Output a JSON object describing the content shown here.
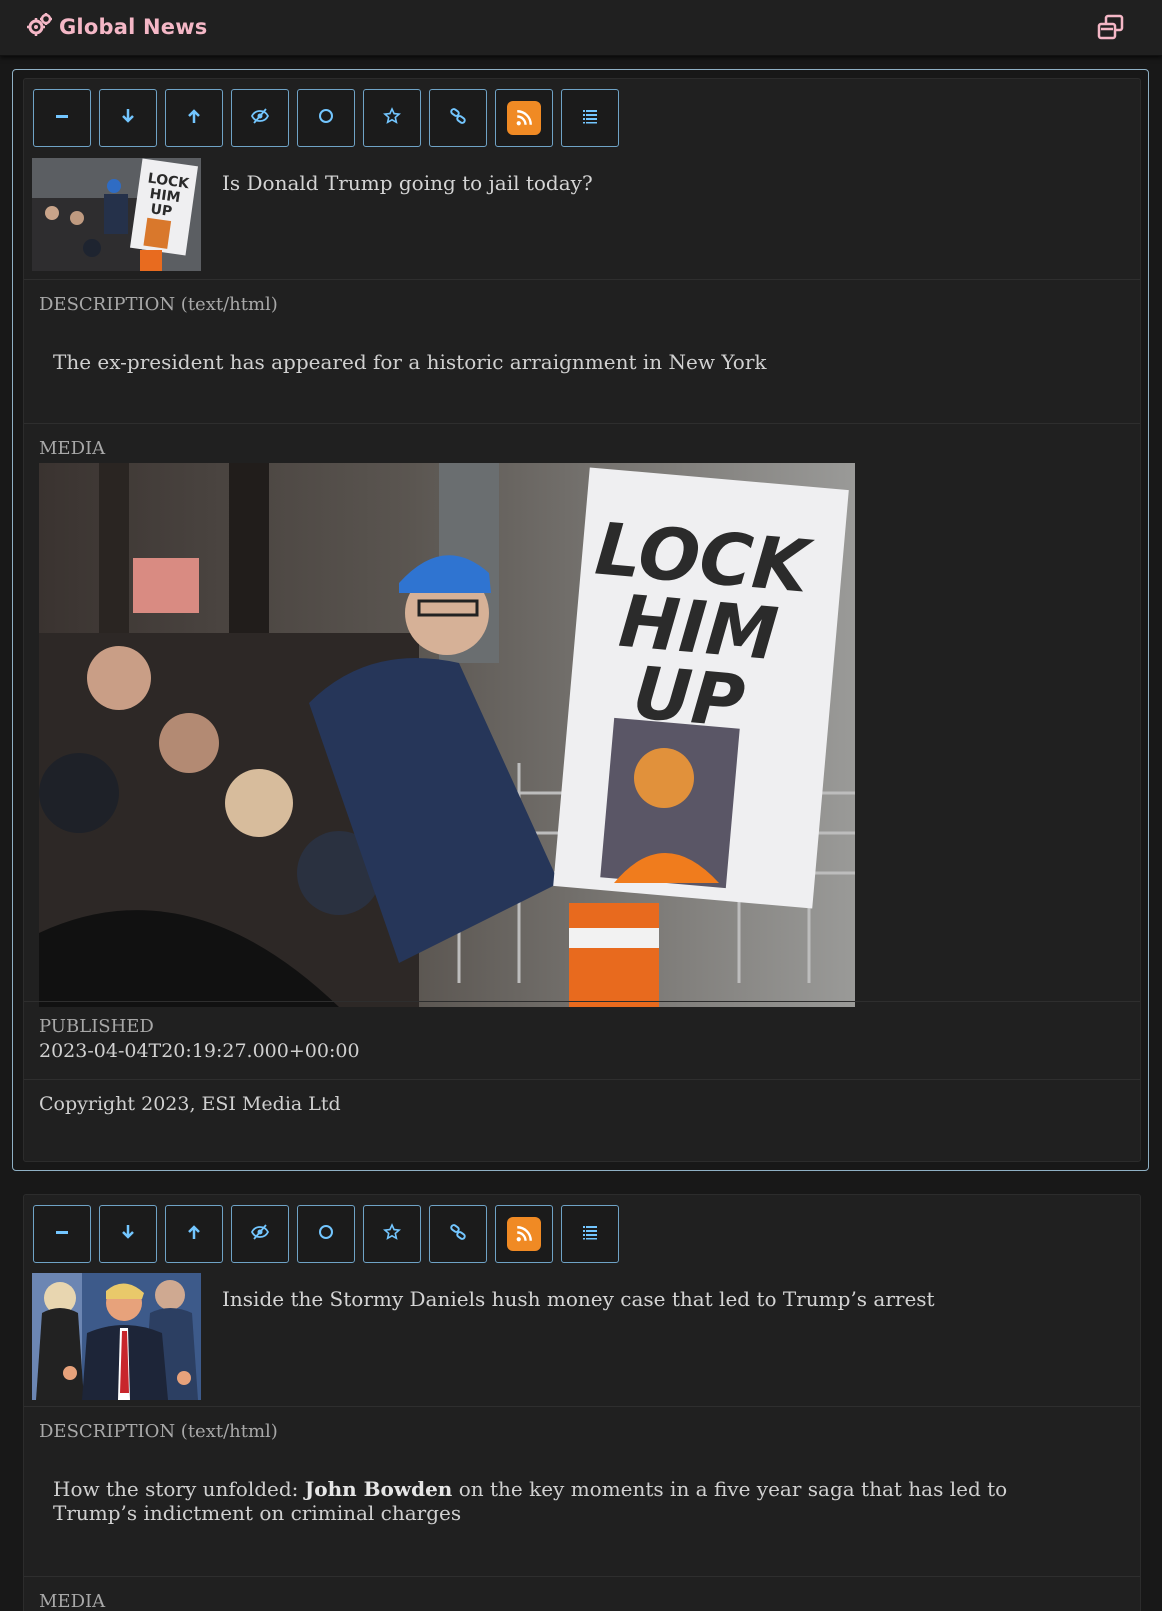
{
  "app": {
    "title": "Global News"
  },
  "toolbar_icons": [
    "minus-icon",
    "arrow-down-icon",
    "arrow-up-icon",
    "eye-slash-icon",
    "circle-icon",
    "star-icon",
    "link-icon",
    "rss-icon",
    "list-icon"
  ],
  "labels": {
    "description": "DESCRIPTION (text/html)",
    "media": "MEDIA",
    "published": "PUBLISHED"
  },
  "items": [
    {
      "headline": "Is Donald Trump going to jail today?",
      "description": "The ex-president has appeared for a historic arraignment in New York",
      "media_sign": [
        "LOCK",
        "HIM",
        "UP"
      ],
      "published": "2023-04-04T20:19:27.000+00:00",
      "copyright": "Copyright 2023, ESI Media Ltd"
    },
    {
      "headline": "Inside the Stormy Daniels hush money case that led to Trump’s arrest",
      "description_prefix": "How the story unfolded: ",
      "description_bold": "John Bowden",
      "description_suffix": " on the key moments in a five year saga that has led to Trump’s indictment on criminal charges"
    }
  ],
  "colors": {
    "accent": "#73c6ff",
    "brand": "#f4b7c6",
    "rss": "#f08a24",
    "selection": "#8fb0c4"
  }
}
